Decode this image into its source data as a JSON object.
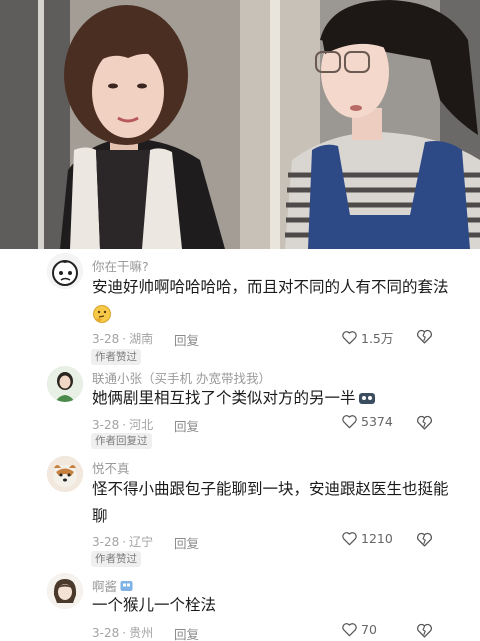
{
  "comments": [
    {
      "username": "你在干嘛?",
      "text": "安迪好帅啊哈哈哈哈，而且对不同的人有不同的套法",
      "date": "3-28",
      "location": "湖南",
      "reply_label": "回复",
      "likes": "1.5万",
      "author_tag": "作者赞过",
      "trailing_emoji": "thinking-face-emoji"
    },
    {
      "username": "联通小张（买手机 办宽带找我）",
      "text": "她俩剧里相互找了个类似对方的另一半",
      "date": "3-28",
      "location": "河北",
      "reply_label": "回复",
      "likes": "5374",
      "author_tag": "作者回复过"
    },
    {
      "username": "悦不真",
      "text": "怪不得小曲跟包子能聊到一块，安迪跟赵医生也挺能聊",
      "date": "3-28",
      "location": "辽宁",
      "reply_label": "回复",
      "likes": "1210",
      "author_tag": "作者赞过"
    },
    {
      "username": "啊酱",
      "text": "一个猴儿一个栓法",
      "date": "3-28",
      "location": "贵州",
      "reply_label": "回复",
      "likes": "70"
    }
  ],
  "icons": {
    "like": "heart-outline-icon",
    "dislike": "broken-heart-icon"
  }
}
